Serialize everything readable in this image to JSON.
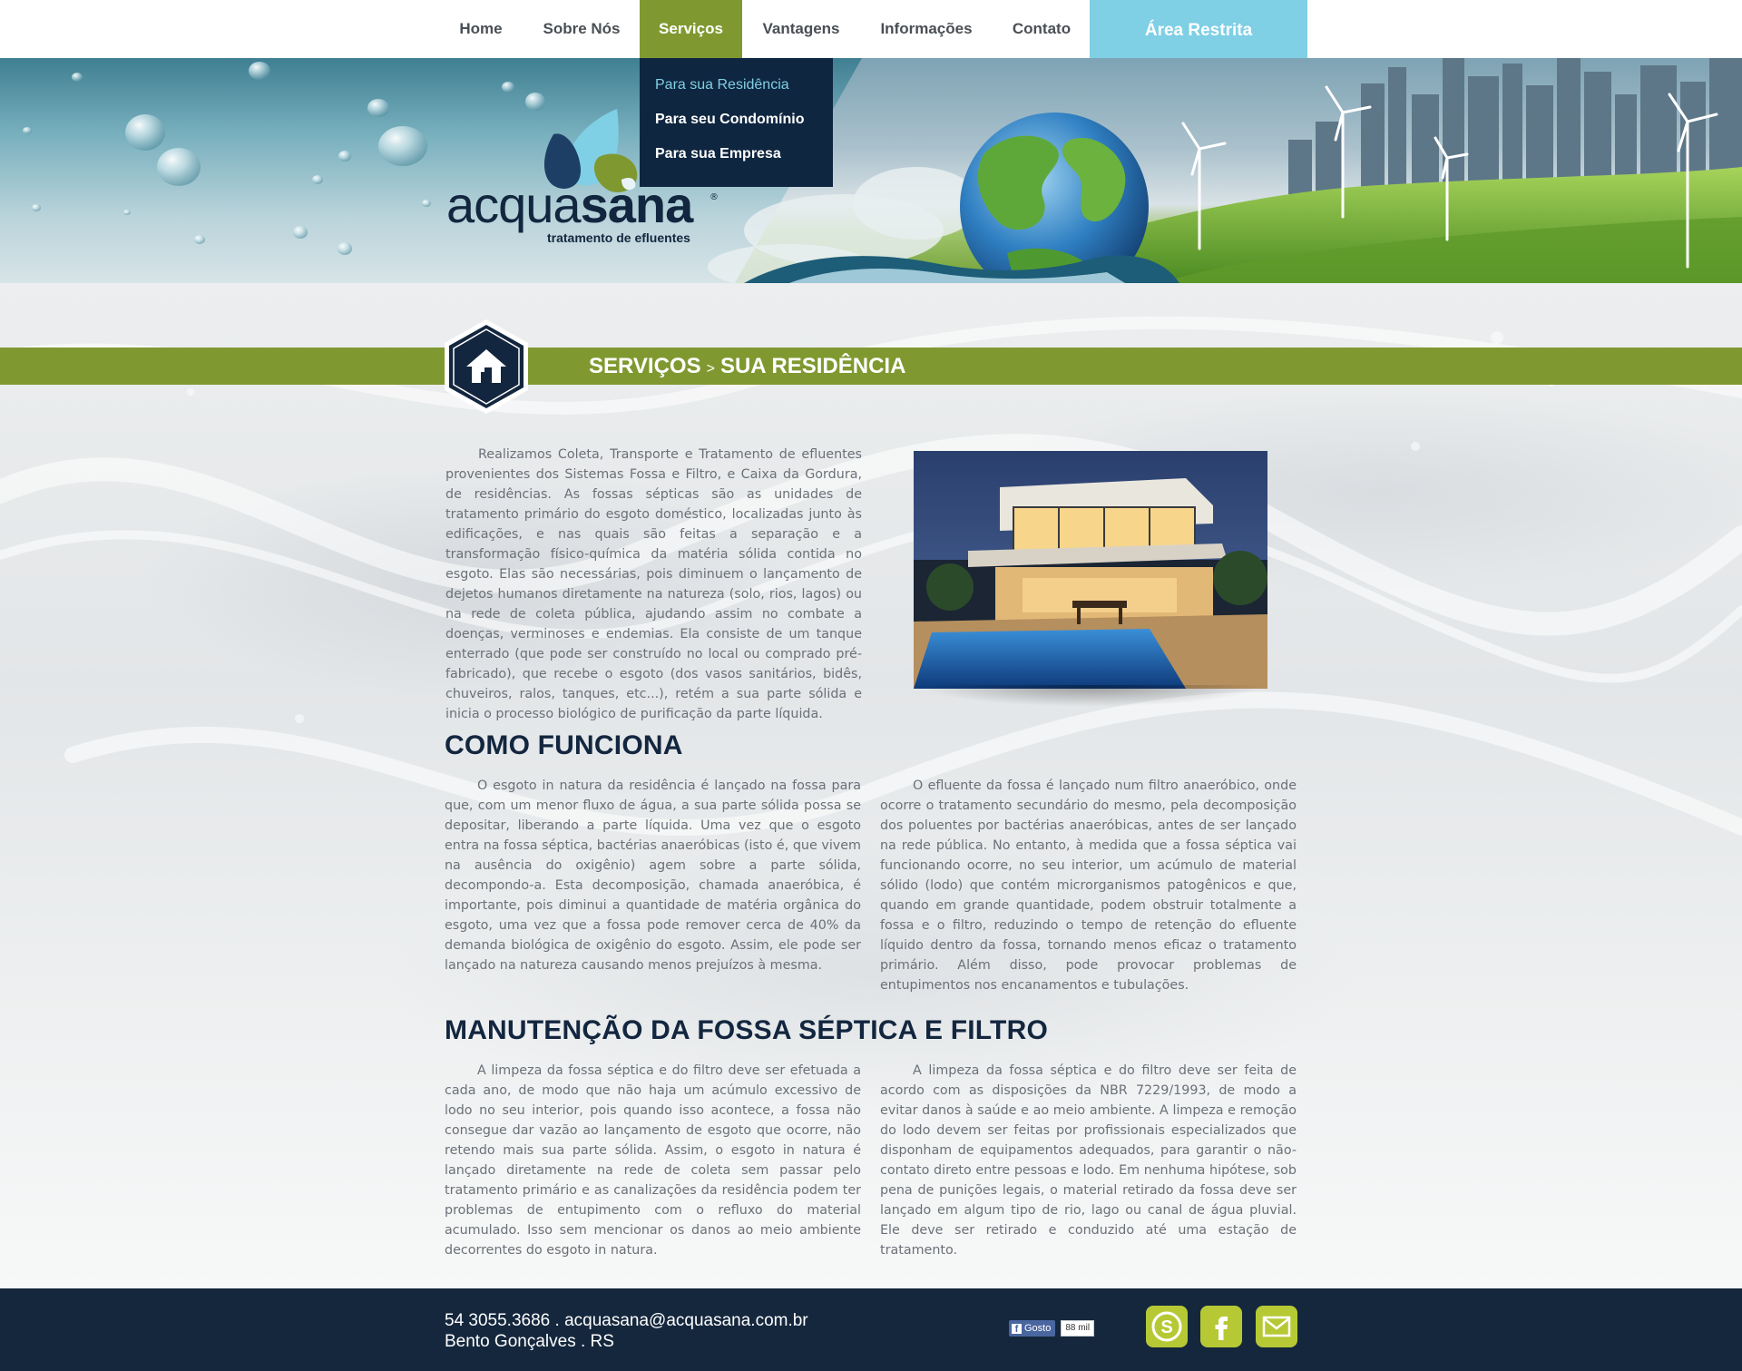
{
  "nav": {
    "items": [
      {
        "label": "Home"
      },
      {
        "label": "Sobre Nós"
      },
      {
        "label": "Serviços",
        "active": true
      },
      {
        "label": "Vantagens"
      },
      {
        "label": "Informações"
      },
      {
        "label": "Contato"
      }
    ],
    "restricted_label": "Área Restrita"
  },
  "dropdown": {
    "items": [
      {
        "label": "Para sua Residência",
        "current": true
      },
      {
        "label": "Para seu Condomínio"
      },
      {
        "label": "Para sua Empresa"
      }
    ]
  },
  "logo": {
    "word_light": "acqua",
    "word_bold": "sana",
    "registered": "®",
    "tagline": "tratamento de efluentes"
  },
  "breadcrumb": {
    "section": "SERVIÇOS",
    "separator": ">",
    "page": "SUA RESIDÊNCIA"
  },
  "intro": "Realizamos Coleta, Transporte e Tratamento de efluentes provenientes dos  Sistemas Fossa e Filtro, e Caixa da Gordura, de residências. As fossas sépticas são as unidades de tratamento primário do esgoto doméstico, localizadas junto às edificações, e nas quais são feitas a separação e a transformação físico-química da matéria sólida contida no esgoto. Elas são necessárias, pois diminuem o lançamento de dejetos humanos diretamente na natureza (solo, rios, lagos) ou na rede de coleta pública, ajudando assim no combate a doenças, verminoses e endemias. Ela consiste de um tanque enterrado (que pode ser construído no local ou comprado pré-fabricado), que recebe o esgoto (dos vasos sanitários, bidês, chuveiros, ralos, tanques, etc...), retém a sua parte sólida e inicia o processo biológico de purificação da parte líquida.",
  "how_it_works": {
    "heading": "COMO FUNCIONA",
    "col1": "O esgoto in natura da residência é lançado na fossa para que, com um menor fluxo de água, a sua parte sólida possa se depositar, liberando a parte líquida. Uma vez que o esgoto entra na fossa séptica, bactérias anaeróbicas (isto é, que vivem na ausência do oxigênio) agem sobre a parte sólida, decompondo-a. Esta decomposição, chamada anaeróbica, é importante, pois diminui a quantidade de matéria orgânica do esgoto, uma vez que a fossa pode remover cerca de 40% da demanda biológica de oxigênio do esgoto. Assim, ele pode ser lançado na natureza causando menos prejuízos à mesma.",
    "col2": "O efluente da fossa é lançado num filtro anaeróbico, onde ocorre o tratamento secundário do mesmo, pela decomposição dos poluentes por bactérias anaeróbicas, antes de ser lançado na rede pública. No entanto, à medida que a fossa séptica vai funcionando ocorre, no seu interior, um acúmulo de material sólido (lodo) que contém microrganismos patogênicos e que, quando em grande quantidade, podem obstruir totalmente a fossa e o filtro, reduzindo o tempo de retenção do efluente líquido dentro da fossa, tornando menos eficaz o tratamento primário. Além disso, pode provocar problemas de entupimentos nos encanamentos e tubulações."
  },
  "maintenance": {
    "heading": "MANUTENÇÃO DA FOSSA SÉPTICA E FILTRO",
    "col1": "A limpeza da fossa séptica e do filtro deve ser efetuada a cada ano, de modo que não haja um acúmulo excessivo de lodo no seu interior, pois quando isso acontece, a fossa não consegue dar vazão ao lançamento de esgoto que ocorre, não retendo mais sua parte sólida. Assim, o esgoto in natura é lançado diretamente na rede de coleta sem passar pelo tratamento primário e as canalizações da residência podem ter problemas de entupimento com o refluxo do material acumulado. Isso sem mencionar os danos ao meio ambiente decorrentes do esgoto in natura.",
    "col2": "A limpeza da fossa séptica e do filtro deve ser feita de acordo com as disposições da NBR 7229/1993, de modo a evitar danos à saúde e ao meio ambiente. A limpeza e remoção do lodo devem ser feitas por profissionais especializados que disponham de equipamentos adequados, para garantir o não-contato direto entre pessoas e lodo. Em nenhuma hipótese, sob pena de punições legais, o material retirado da fossa deve ser lançado em algum tipo de rio, lago ou canal de água pluvial. Ele deve ser retirado e conduzido até uma estação de tratamento."
  },
  "footer": {
    "line1": "54 3055.3686  .  acquasana@acquasana.com.br",
    "line2": "Bento Gonçalves  .  RS",
    "like_label": "Gosto",
    "like_count": "88 mil"
  },
  "icons": {
    "home": "home-icon",
    "skype": "skype-icon",
    "facebook": "facebook-icon",
    "email": "email-icon"
  },
  "colors": {
    "nav_active": "#7f9930",
    "restricted": "#7fcfe5",
    "navy": "#13263f",
    "social": "#b6c935"
  }
}
